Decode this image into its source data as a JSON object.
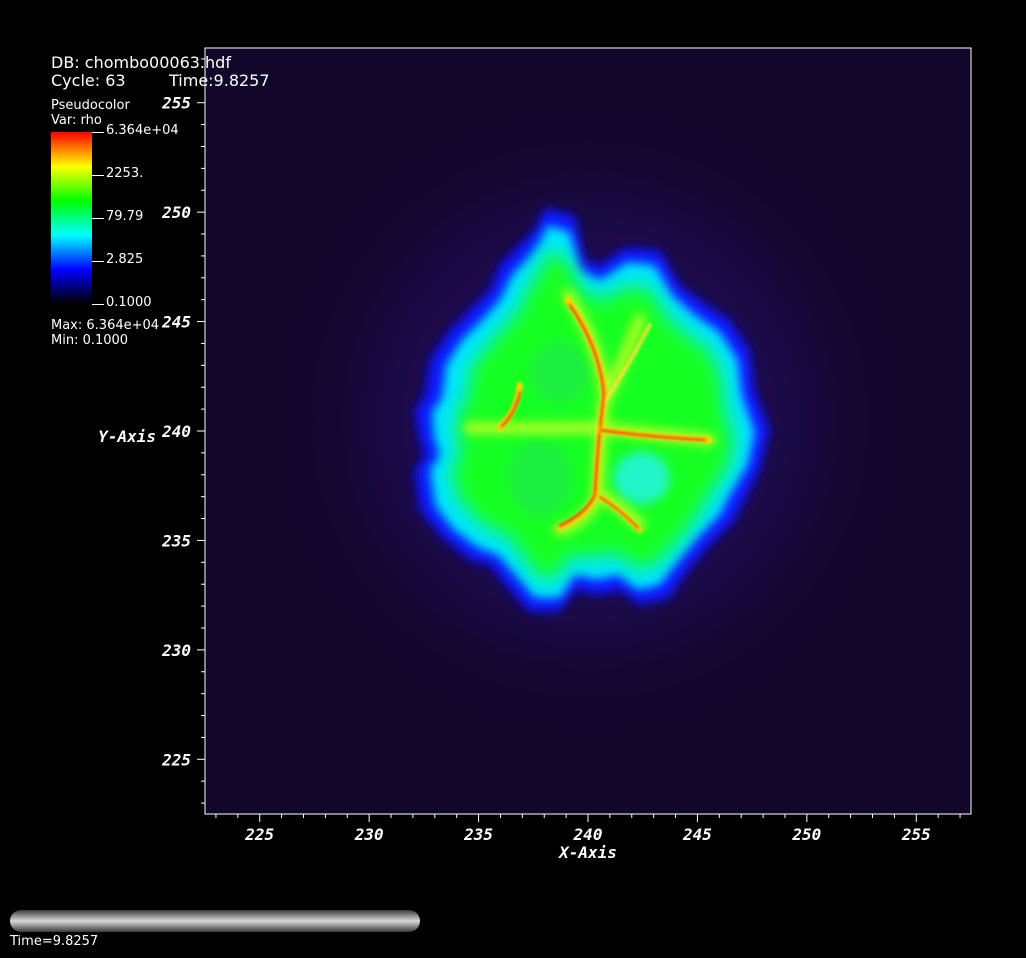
{
  "header": {
    "db_label": "DB: chombo00063.hdf",
    "cycle_label": "Cycle: 63",
    "time_label": "Time:9.8257"
  },
  "legend": {
    "plot_type": "Pseudocolor",
    "var_label": "Var: rho",
    "ticks": [
      "6.364e+04",
      "2253.",
      "79.79",
      "2.825",
      "0.1000"
    ],
    "max_label": "Max:  6.364e+04",
    "min_label": "Min:  0.1000",
    "colors": [
      "#ff0000",
      "#ffff00",
      "#00ff00",
      "#00ffff",
      "#0000ff",
      "#000000"
    ]
  },
  "chart_data": {
    "type": "heatmap",
    "variable": "rho",
    "xlabel": "X-Axis",
    "ylabel": "Y-Axis",
    "xlim": [
      222.5,
      257.5
    ],
    "ylim": [
      222.5,
      257.5
    ],
    "x_ticks": [
      225,
      230,
      235,
      240,
      245,
      250,
      255
    ],
    "y_ticks": [
      225,
      230,
      235,
      240,
      245,
      250,
      255
    ],
    "color_scale": "log",
    "value_range": [
      0.1,
      63640
    ],
    "background_color": "#1a0a3a"
  },
  "time_slider": {
    "label": "Time=9.8257"
  }
}
